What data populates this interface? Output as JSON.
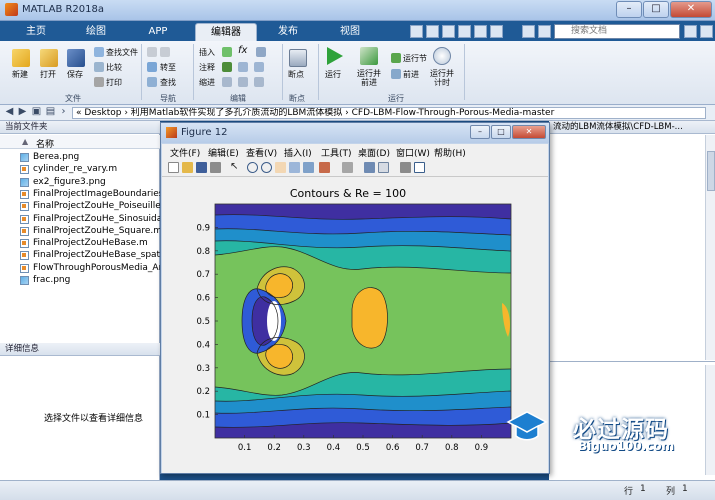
{
  "window": {
    "title": "MATLAB R2018a",
    "min": "–",
    "max": "□",
    "close": "✕"
  },
  "tabs": [
    "主页",
    "绘图",
    "APP",
    "编辑器",
    "发布",
    "视图"
  ],
  "search": {
    "placeholder": "搜索文档"
  },
  "ribbon": {
    "new": "新建",
    "open": "打开",
    "save": "保存",
    "find_files": "查找文件",
    "compare": "比较",
    "print": "打印",
    "goto": "转至",
    "find": "查找",
    "insert": "插入",
    "comment": "注释",
    "indent": "缩进",
    "breakpoints": "断点",
    "run": "运行",
    "run_advance": "运行并\n前进",
    "run_section": "运行节",
    "advance": "前进",
    "run_time": "运行并\n计时",
    "groups": [
      "文件",
      "导航",
      "编辑",
      "断点",
      "运行"
    ]
  },
  "address": {
    "path": "« Desktop › 利用Matlab软件实现了多孔介质流动的LBM流体模拟 › CFD-LBM-Flow-Through-Porous-Media-master"
  },
  "left_panel": {
    "header": "当前文件夹",
    "column": "名称",
    "files": [
      {
        "name": "Berea.png",
        "type": "png"
      },
      {
        "name": "cylinder_re_vary.m",
        "type": "m"
      },
      {
        "name": "ex2_figure3.png",
        "type": "png"
      },
      {
        "name": "FinalProjectImageBoundaries.m",
        "type": "m"
      },
      {
        "name": "FinalProjectZouHe_Poiseuille.m",
        "type": "m"
      },
      {
        "name": "FinalProjectZouHe_Sinosuidal.m",
        "type": "m"
      },
      {
        "name": "FinalProjectZouHe_Square.m",
        "type": "m"
      },
      {
        "name": "FinalProjectZouHeBase.m",
        "type": "m"
      },
      {
        "name": "FinalProjectZouHeBase_spatconv",
        "type": "m"
      },
      {
        "name": "FlowThroughPorousMedia_Arjun",
        "type": "m"
      },
      {
        "name": "frac.png",
        "type": "png"
      }
    ],
    "detail_header": "详细信息",
    "detail_text": "选择文件以查看详细信息"
  },
  "right_panel": {
    "header": "流动的LBM流体模拟\\CFD-LBM-..."
  },
  "status": {
    "row_label": "行",
    "row": "1",
    "col_label": "列",
    "col": "1"
  },
  "figure": {
    "title": "Figure 12",
    "menu": [
      "文件(F)",
      "编辑(E)",
      "查看(V)",
      "插入(I)",
      "工具(T)",
      "桌面(D)",
      "窗口(W)",
      "帮助(H)"
    ]
  },
  "watermark": {
    "cn": "必过源码",
    "en": "Biguo100.com"
  },
  "colors": {
    "accent": "#1f5a96",
    "contour_levels": [
      "#3f2fa1",
      "#2f5bd7",
      "#1f8fcb",
      "#27b6a4",
      "#76c35c",
      "#cfc23b",
      "#f7b62c",
      "#f9e427"
    ]
  },
  "chart_data": {
    "type": "contour",
    "title": "Contours & Re = 100",
    "xticks": [
      "0.1",
      "0.2",
      "0.3",
      "0.4",
      "0.5",
      "0.6",
      "0.7",
      "0.8",
      "0.9"
    ],
    "yticks": [
      "0.9",
      "0.8",
      "0.7",
      "0.6",
      "0.5",
      "0.4",
      "0.3",
      "0.2",
      "0.1"
    ],
    "xlim": [
      0,
      1
    ],
    "ylim": [
      0,
      1
    ],
    "cylinder": {
      "x": 0.2,
      "y": 0.5
    }
  }
}
